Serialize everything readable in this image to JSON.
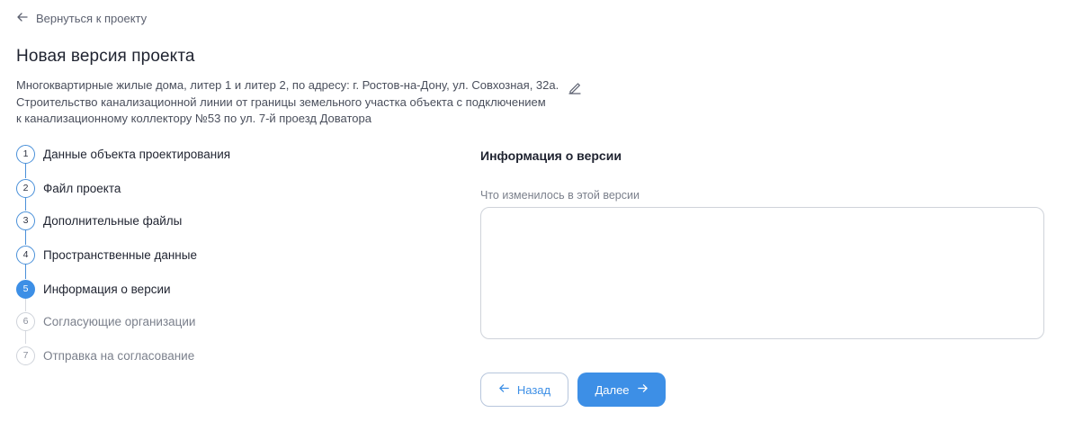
{
  "header": {
    "back_link_label": "Вернуться к проекту",
    "back_icon": "arrow-left-icon",
    "title": "Новая версия проекта"
  },
  "project": {
    "description_lines": [
      "Многоквартирные жилые дома, литер 1 и литер 2, по адресу: г. Ростов-на-Дону, ул. Совхозная, 32а.",
      "Строительство канализационной линии от границы земельного участка объекта с подключением",
      "к канализационному коллектору №53 по ул. 7-й проезд Доватора"
    ],
    "edit_icon": "pencil-icon"
  },
  "stepper": {
    "steps": [
      {
        "number": "1",
        "label": "Данные объекта проектирования",
        "state": "completed"
      },
      {
        "number": "2",
        "label": "Файл проекта",
        "state": "completed"
      },
      {
        "number": "3",
        "label": "Дополнительные файлы",
        "state": "completed"
      },
      {
        "number": "4",
        "label": "Пространственные данные",
        "state": "completed"
      },
      {
        "number": "5",
        "label": "Информация о версии",
        "state": "active"
      },
      {
        "number": "6",
        "label": "Согласующие организации",
        "state": "pending"
      },
      {
        "number": "7",
        "label": "Отправка на согласование",
        "state": "pending"
      }
    ]
  },
  "form": {
    "section_title": "Информация о версии",
    "changes_label": "Что изменилось в этой версии",
    "changes_value": "",
    "changes_placeholder": ""
  },
  "actions": {
    "back_label": "Назад",
    "next_label": "Далее",
    "back_icon": "arrow-left-icon",
    "next_icon": "arrow-right-icon"
  },
  "colors": {
    "accent": "#3d8fe6",
    "completed_outline": "#4a90d9",
    "pending_outline": "#cfd3da",
    "text_primary": "#1f2330",
    "text_secondary": "#7b808c"
  }
}
